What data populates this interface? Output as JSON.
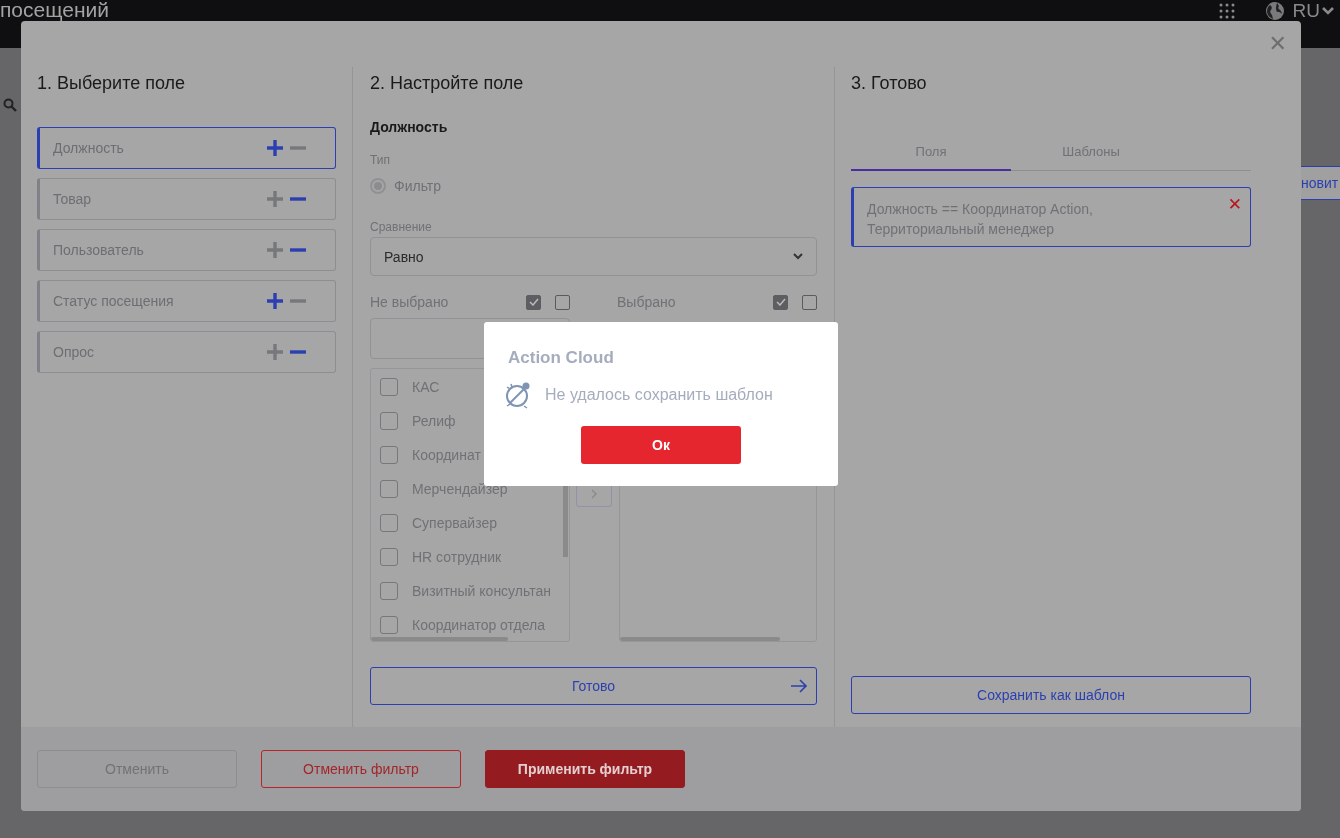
{
  "page": {
    "title_fragment": "посещений",
    "language": "RU",
    "button_fragment": "новит"
  },
  "filter_modal": {
    "steps": [
      {
        "title": "1. Выберите поле"
      },
      {
        "title": "2. Настройте поле"
      },
      {
        "title": "3. Готово"
      }
    ],
    "fields": [
      {
        "label": "Должность",
        "selected": true,
        "plus_active": true,
        "minus_active": false
      },
      {
        "label": "Товар",
        "selected": false,
        "plus_active": false,
        "minus_active": true
      },
      {
        "label": "Пользователь",
        "selected": false,
        "plus_active": false,
        "minus_active": true
      },
      {
        "label": "Статус посещения",
        "selected": false,
        "plus_active": true,
        "minus_active": false
      },
      {
        "label": "Опрос",
        "selected": false,
        "plus_active": false,
        "minus_active": true
      }
    ],
    "config": {
      "field_name": "Должность",
      "type_label": "Тип",
      "type_option": {
        "label": "Фильтр",
        "selected": true
      },
      "comparison_label": "Сравнение",
      "comparison_value": "Равно",
      "not_selected": {
        "title": "Не выбрано",
        "select_all_checked": true,
        "deselect_all_checked": false
      },
      "selected_list": {
        "title": "Выбрано",
        "select_all_checked": true,
        "deselect_all_checked": false
      },
      "options": [
        {
          "label": "КАС",
          "checked": false
        },
        {
          "label": "Релиф",
          "checked": false
        },
        {
          "label": "Координат",
          "checked": false
        },
        {
          "label": "Мерчендайзер",
          "checked": false
        },
        {
          "label": "Супервайзер",
          "checked": false
        },
        {
          "label": "HR сотрудник",
          "checked": false
        },
        {
          "label": "Визитный консультан",
          "checked": false
        },
        {
          "label": "Координатор отдела",
          "checked": false
        }
      ],
      "done_button": "Готово"
    },
    "result": {
      "tabs": [
        {
          "label": "Поля",
          "selected": true
        },
        {
          "label": "Шаблоны",
          "selected": false
        }
      ],
      "conditions": [
        "Должность == Координатор Action, Территориальный менеджер"
      ],
      "remove_icon": "✕",
      "save_button": "Сохранить как шаблон"
    },
    "close_icon": "✕",
    "footer": [
      {
        "kind": "disabled",
        "label": "Отменить"
      },
      {
        "kind": "outline",
        "label": "Отменить фильтр"
      },
      {
        "kind": "primary",
        "label": "Применить фильтр"
      }
    ]
  },
  "alert": {
    "title": "Action Cloud",
    "message": "Не удалось сохранить шаблон",
    "button": "Ок"
  }
}
